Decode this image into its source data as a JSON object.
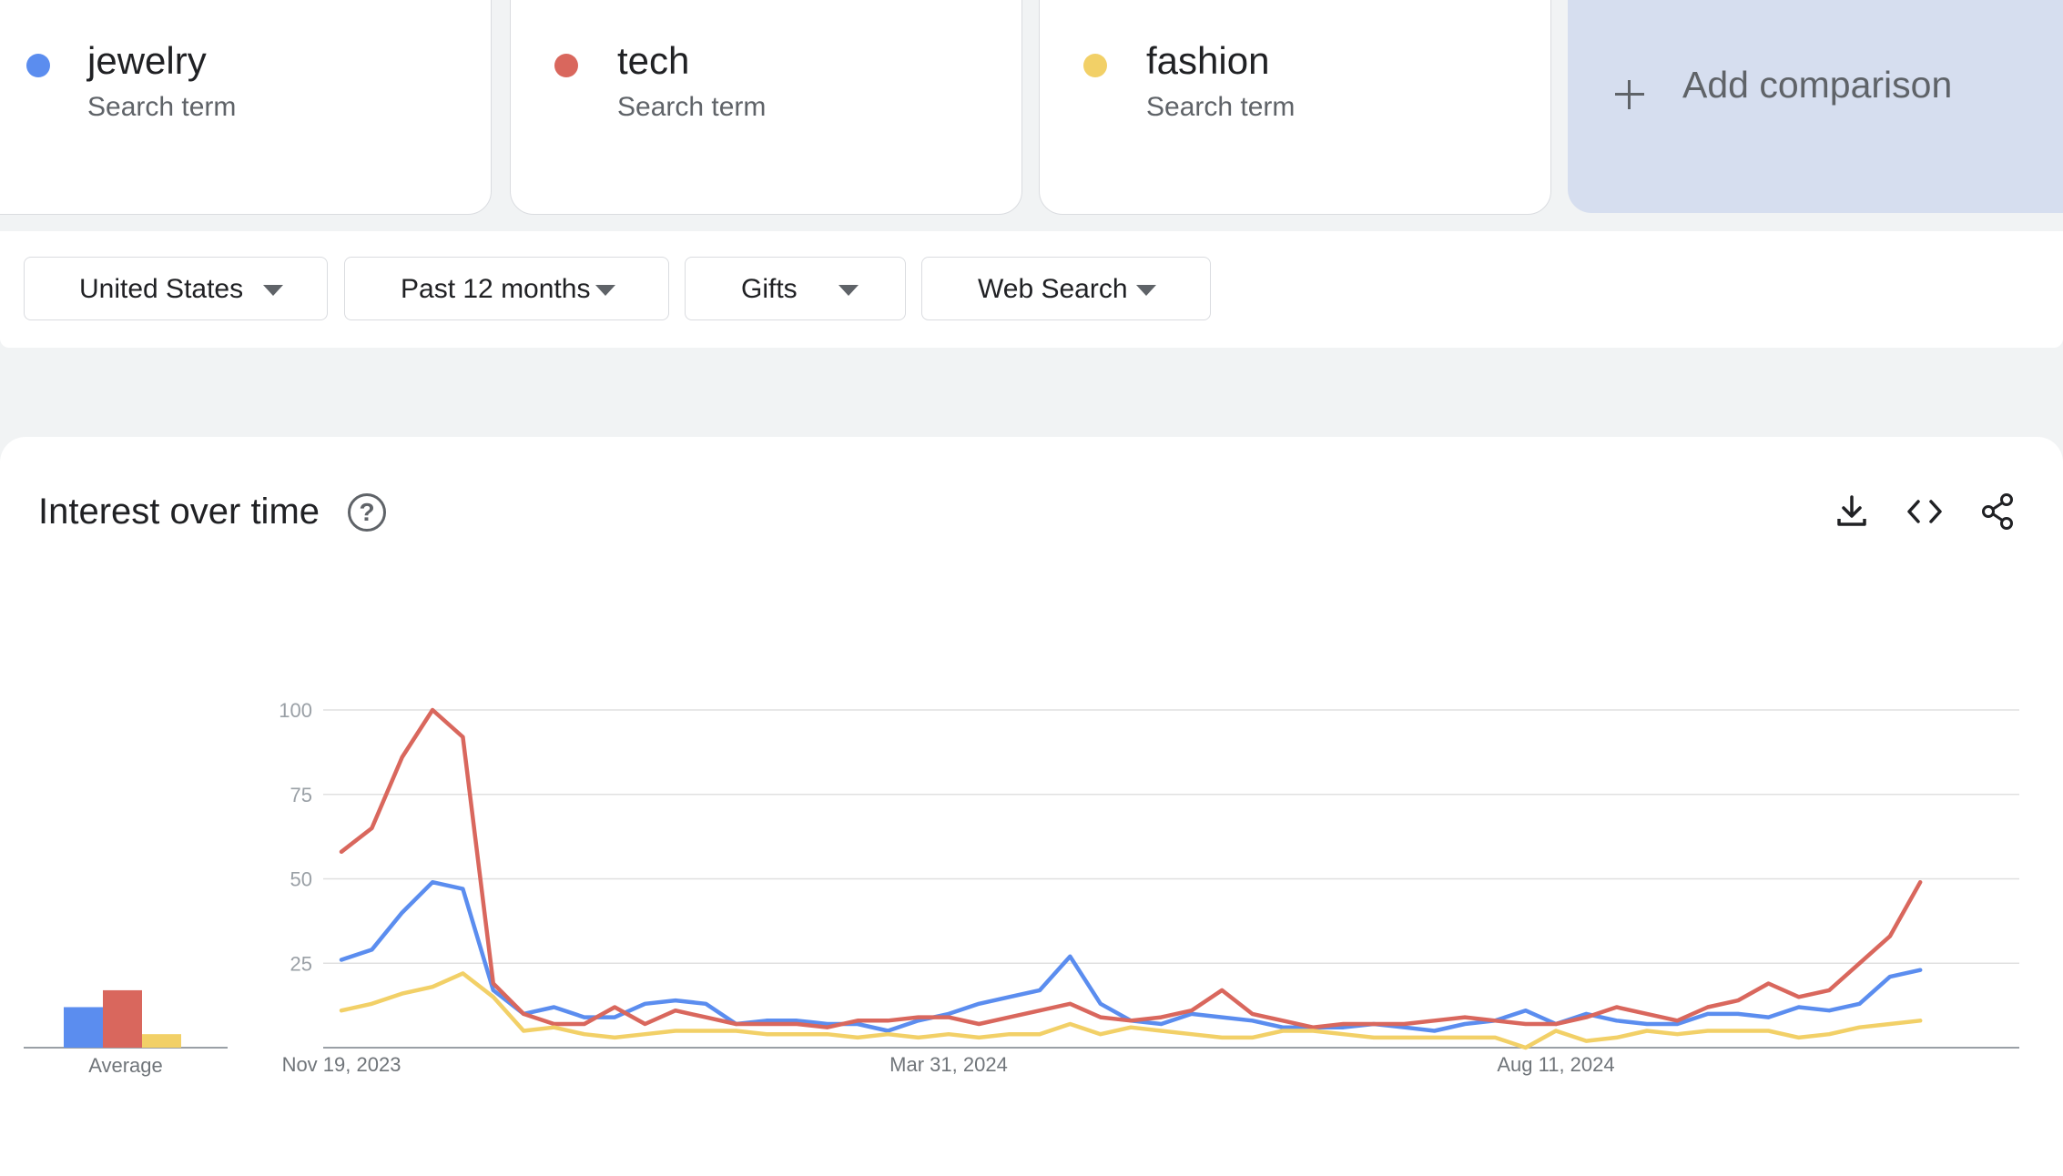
{
  "terms": [
    {
      "name": "jewelry",
      "type": "Search term",
      "color": "#5b8def"
    },
    {
      "name": "tech",
      "type": "Search term",
      "color": "#d9675d"
    },
    {
      "name": "fashion",
      "type": "Search term",
      "color": "#f2d067"
    }
  ],
  "add_comparison": "Add comparison",
  "filters": {
    "region": "United States",
    "period": "Past 12 months",
    "category": "Gifts",
    "property": "Web Search"
  },
  "panel": {
    "title": "Interest over time",
    "help_glyph": "?"
  },
  "icons": [
    "download-icon",
    "embed-code-icon",
    "share-icon",
    "help-icon",
    "chevron-down-icon",
    "plus-icon"
  ],
  "chart_data": {
    "type": "line",
    "yticks": [
      25,
      50,
      75,
      100
    ],
    "ylim": [
      0,
      100
    ],
    "x_tick_labels": [
      "Nov 19, 2023",
      "Mar 31, 2024",
      "Aug 11, 2024"
    ],
    "x_tick_positions": [
      0,
      20,
      40
    ],
    "average_label": "Average",
    "averages": [
      12,
      17,
      4
    ],
    "grid": true,
    "series": [
      {
        "name": "jewelry",
        "color": "#5b8def",
        "values": [
          26,
          29,
          40,
          49,
          47,
          17,
          10,
          12,
          9,
          9,
          13,
          14,
          13,
          7,
          8,
          8,
          7,
          7,
          5,
          8,
          10,
          13,
          15,
          17,
          27,
          13,
          8,
          7,
          10,
          9,
          8,
          6,
          6,
          6,
          7,
          6,
          5,
          7,
          8,
          11,
          7,
          10,
          8,
          7,
          7,
          10,
          10,
          9,
          12,
          11,
          13,
          21,
          23
        ]
      },
      {
        "name": "tech",
        "color": "#d9675d",
        "values": [
          58,
          65,
          86,
          100,
          92,
          19,
          10,
          7,
          7,
          12,
          7,
          11,
          9,
          7,
          7,
          7,
          6,
          8,
          8,
          9,
          9,
          7,
          9,
          11,
          13,
          9,
          8,
          9,
          11,
          17,
          10,
          8,
          6,
          7,
          7,
          7,
          8,
          9,
          8,
          7,
          7,
          9,
          12,
          10,
          8,
          12,
          14,
          19,
          15,
          17,
          25,
          33,
          49
        ]
      },
      {
        "name": "fashion",
        "color": "#f2d067",
        "values": [
          11,
          13,
          16,
          18,
          22,
          15,
          5,
          6,
          4,
          3,
          4,
          5,
          5,
          5,
          4,
          4,
          4,
          3,
          4,
          3,
          4,
          3,
          4,
          4,
          7,
          4,
          6,
          5,
          4,
          3,
          3,
          5,
          5,
          4,
          3,
          3,
          3,
          3,
          3,
          0,
          5,
          2,
          3,
          5,
          4,
          5,
          5,
          5,
          3,
          4,
          6,
          7,
          8
        ]
      }
    ]
  }
}
